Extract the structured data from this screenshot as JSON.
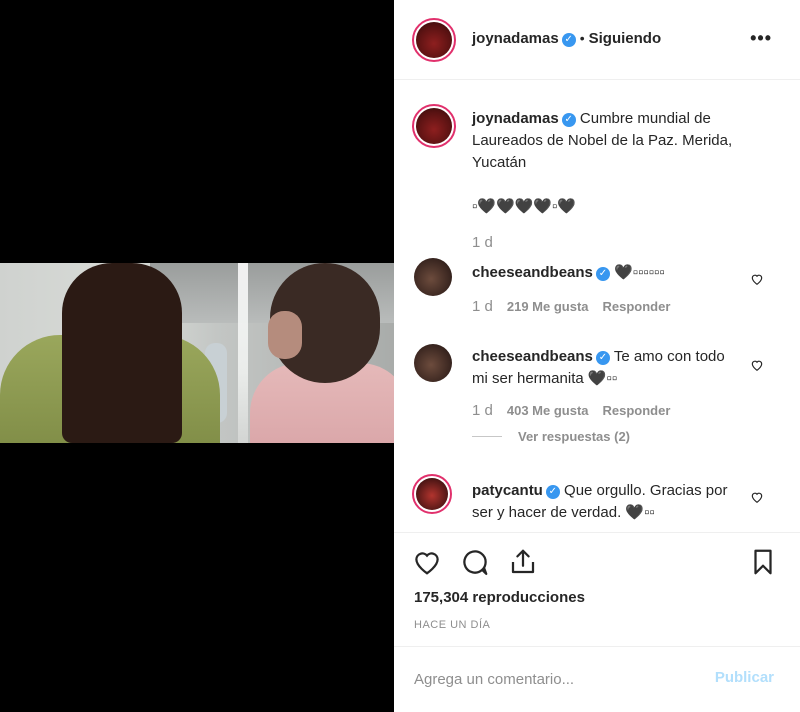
{
  "post": {
    "username": "joynadamas",
    "following_label": "Siguiendo",
    "more_label": "•••"
  },
  "caption": {
    "username": "joynadamas",
    "text": "Cumbre mundial de Laureados de Nobel de la Paz. Merida, Yucatán",
    "emoji_line": "▫🖤🖤🖤🖤▫🖤",
    "age": "1 d"
  },
  "comments": [
    {
      "username": "cheeseandbeans",
      "text": "🖤▫▫▫▫▫▫",
      "age": "1 d",
      "likes": "219 Me gusta",
      "reply_label": "Responder"
    },
    {
      "username": "cheeseandbeans",
      "text": "Te amo con todo mi ser hermanita 🖤▫▫",
      "age": "1 d",
      "likes": "403 Me gusta",
      "reply_label": "Responder",
      "view_replies": "Ver respuestas (2)"
    },
    {
      "username": "patycantu",
      "text": "Que orgullo. Gracias por ser y hacer de verdad. 🖤▫▫"
    }
  ],
  "stats": {
    "views": "175,304 reproducciones",
    "posted": "HACE UN DÍA"
  },
  "comment_box": {
    "placeholder": "Agrega un comentario...",
    "publish_label": "Publicar"
  },
  "icons": {
    "like": "heart-icon",
    "comment": "comment-icon",
    "share": "share-icon",
    "save": "bookmark-icon"
  },
  "colors": {
    "verified": "#3897f0",
    "story_ring": "#e1306c",
    "publish_disabled": "#b2dffc",
    "muted": "#8e8e8e"
  }
}
